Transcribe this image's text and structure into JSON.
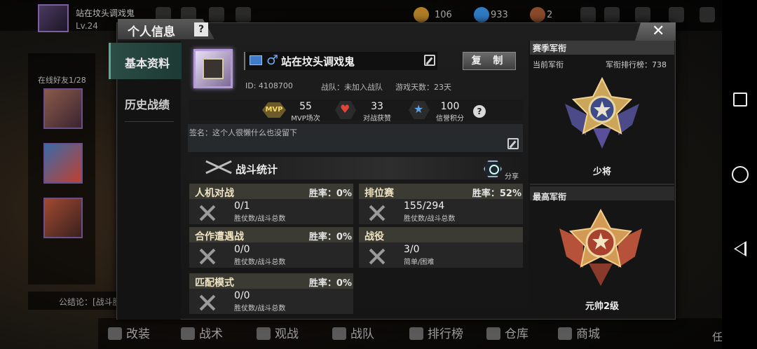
{
  "topbar": {
    "player_name": "站在坟头调戏鬼",
    "level": "Lv.24",
    "gold": "106",
    "diamond": "933",
    "tickets": "2"
  },
  "background": {
    "online_friends": "在线好友1/28",
    "chat_text": "公结论：[战斗胜利",
    "bottom_nav": [
      "改装",
      "战术",
      "观战",
      "战队",
      "排行榜",
      "仓库",
      "商城"
    ],
    "task": "任务"
  },
  "dialog": {
    "title": "个人信息",
    "help": "?",
    "close": "✕"
  },
  "tabs": {
    "basic_info": "基本资料",
    "history": "历史战绩"
  },
  "profile": {
    "gender_symbol": "♂",
    "name": "站在坟头调戏鬼",
    "copy_button": "复 制",
    "id_text": "ID: 4108700",
    "team_text": "战队：未加入战队",
    "days_text": "游戏天数：23天",
    "mvp_badge": "MVP",
    "mvp_count": "55",
    "mvp_label": "MVP场次",
    "likes_count": "33",
    "likes_label": "对战获赞",
    "credit_count": "100",
    "credit_label": "信誉积分",
    "help": "?",
    "signature": "签名：这个人很懒什么也没留下"
  },
  "battle_stats": {
    "title": "战斗统计",
    "share": "分享",
    "cards": [
      {
        "title": "人机对战",
        "rate": "胜率：0%",
        "value": "0/1",
        "sub": "胜仗数/战斗总数"
      },
      {
        "title": "排位赛",
        "rate": "胜率：52%",
        "value": "155/294",
        "sub": "胜仗数/战斗总数"
      },
      {
        "title": "合作遭遇战",
        "rate": "胜率：0%",
        "value": "0/0",
        "sub": "胜仗数/战斗总数"
      },
      {
        "title": "战役",
        "rate": "",
        "value": "3/0",
        "sub": "简单/困难"
      },
      {
        "title": "匹配模式",
        "rate": "胜率：0%",
        "value": "0/0",
        "sub": "胜仗数/战斗总数"
      }
    ]
  },
  "rank": {
    "season_header": "赛季军衔",
    "current_label": "当前军衔",
    "rank_list_label": "军衔排行榜：738",
    "current_rank_name": "少将",
    "highest_header": "最高军衔",
    "highest_rank_name": "元帅2级"
  }
}
